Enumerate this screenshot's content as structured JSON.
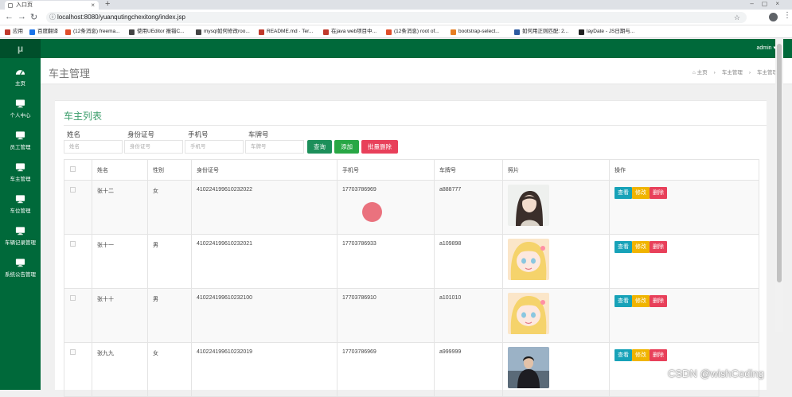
{
  "browser": {
    "tab_title": "入口页",
    "url": "localhost:8080/yuanqutingchexitong/index.jsp",
    "bookmarks": [
      {
        "label": "应用",
        "color": "#c0392b"
      },
      {
        "label": "百度翻译",
        "color": "#1a73e8"
      },
      {
        "label": "(12条消息) freema...",
        "color": "#e04e2a"
      },
      {
        "label": "使用UEditor 报错C...",
        "color": "#444444"
      },
      {
        "label": "mysql如何修改roo...",
        "color": "#444444"
      },
      {
        "label": "README.md · Ter...",
        "color": "#c0392b"
      },
      {
        "label": "在java web项目中...",
        "color": "#c0392b"
      },
      {
        "label": "(12条消息) root of...",
        "color": "#e04e2a"
      },
      {
        "label": "bootstrap-select...",
        "color": "#e67e22"
      },
      {
        "label": "如何用正则匹配: 2...",
        "color": "#2c5aa0"
      },
      {
        "label": "layDate - JS日期与...",
        "color": "#222222"
      }
    ]
  },
  "header": {
    "brand": "μ",
    "user_menu": "admin ▾"
  },
  "sidebar": {
    "items": [
      {
        "label": "主页",
        "icon": "dashboard-icon"
      },
      {
        "label": "个人中心",
        "icon": "monitor-icon"
      },
      {
        "label": "员工管理",
        "icon": "monitor-icon"
      },
      {
        "label": "车主管理",
        "icon": "monitor-icon"
      },
      {
        "label": "车位管理",
        "icon": "monitor-icon"
      },
      {
        "label": "车辆记录管理",
        "icon": "monitor-icon"
      },
      {
        "label": "系统公告管理",
        "icon": "monitor-icon"
      }
    ]
  },
  "page": {
    "title": "车主管理",
    "breadcrumb": [
      "⌂ 主页",
      "车主管理",
      "车主管理"
    ],
    "panel_title": "车主列表"
  },
  "search": {
    "fields": [
      {
        "label": "姓名",
        "placeholder": "姓名"
      },
      {
        "label": "身份证号",
        "placeholder": "身份证号"
      },
      {
        "label": "手机号",
        "placeholder": "手机号"
      },
      {
        "label": "车牌号",
        "placeholder": "车牌号"
      }
    ],
    "query_label": "查询",
    "add_label": "添加",
    "batch_delete_label": "批量删除"
  },
  "table": {
    "headers": [
      "",
      "姓名",
      "性别",
      "身份证号",
      "手机号",
      "车牌号",
      "照片",
      "操作"
    ],
    "rows": [
      {
        "name": "张十二",
        "gender": "女",
        "id_no": "410224199610232022",
        "phone": "17703786969",
        "plate": "a888777",
        "photo": "portrait-woman"
      },
      {
        "name": "张十一",
        "gender": "男",
        "id_no": "410224199610232021",
        "phone": "17703786933",
        "plate": "a109898",
        "photo": "anime-girl"
      },
      {
        "name": "张十十",
        "gender": "男",
        "id_no": "410224199610232100",
        "phone": "17703786910",
        "plate": "a101010",
        "photo": "anime-girl"
      },
      {
        "name": "张九九",
        "gender": "女",
        "id_no": "410224199610232019",
        "phone": "17703786969",
        "plate": "a999999",
        "photo": "portrait-man"
      }
    ],
    "actions": {
      "view": "查看",
      "edit": "修改",
      "delete": "删除"
    }
  },
  "watermark": "CSDN @wishCoding",
  "colors": {
    "sidebar": "#00693a",
    "accent": "#3a9d6a",
    "view": "#17a2b8",
    "edit": "#f0b400",
    "delete": "#e8405a",
    "query": "#1c8f5a",
    "add": "#28a745"
  }
}
